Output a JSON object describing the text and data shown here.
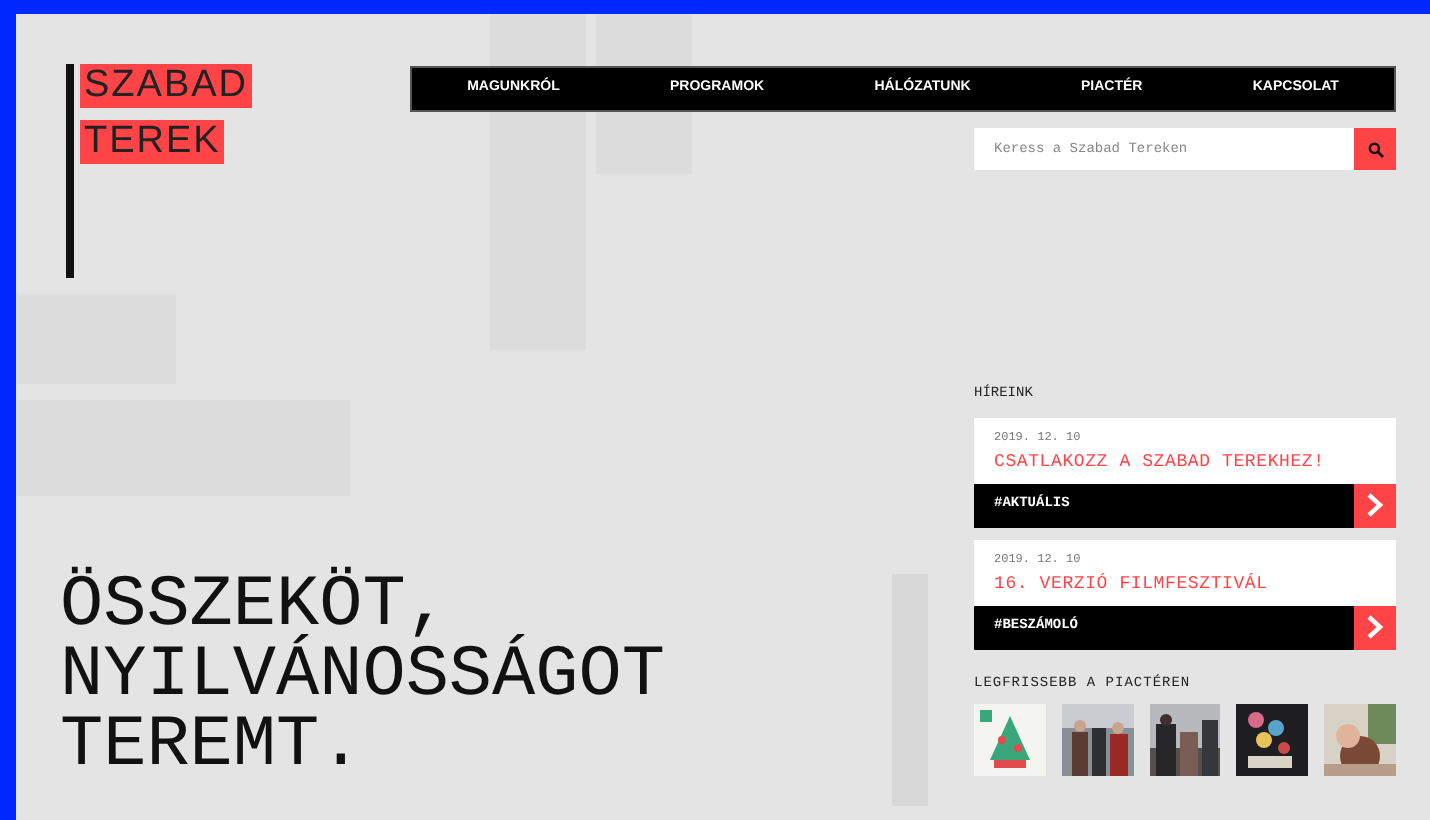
{
  "logo": {
    "lines": [
      "SZABAD",
      "TEREK"
    ]
  },
  "nav": {
    "items": [
      {
        "label": "MAGUNKRÓL"
      },
      {
        "label": "PROGRAMOK"
      },
      {
        "label": "HÁLÓZATUNK"
      },
      {
        "label": "PIACTÉR"
      },
      {
        "label": "KAPCSOLAT"
      }
    ]
  },
  "search": {
    "placeholder": "Keress a Szabad Tereken"
  },
  "headline": {
    "lines": [
      "ÖSSZEKÖT,",
      "NYILVÁNOSSÁGOT",
      "TEREMT."
    ]
  },
  "news": {
    "title": "HÍREINK",
    "items": [
      {
        "date": "2019. 12. 10",
        "title": "CSATLAKOZZ A SZABAD TEREKHEZ!",
        "tag": "#AKTUÁLIS"
      },
      {
        "date": "2019. 12. 10",
        "title": "16. VERZIÓ FILMFESZTIVÁL",
        "tag": "#BESZÁMOLÓ"
      }
    ]
  },
  "market": {
    "title": "LEGFRISSEBB A PIACTÉREN"
  }
}
